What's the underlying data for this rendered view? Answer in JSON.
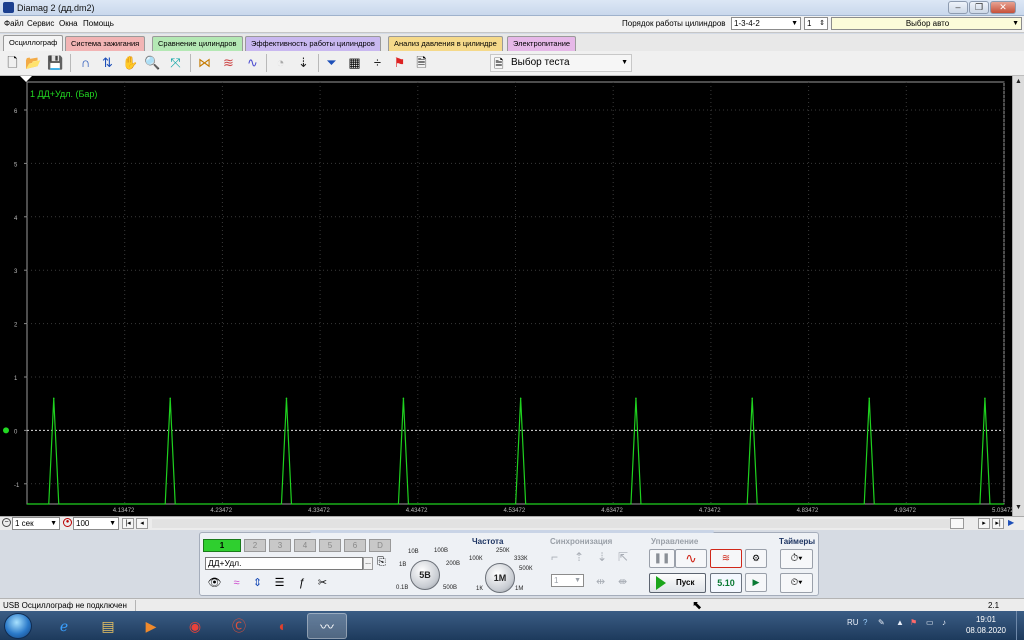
{
  "window": {
    "title": "Diamag 2 (дд.dm2)",
    "minimize": "–",
    "maximize": "❐",
    "close": "✕"
  },
  "menu": {
    "items": [
      "Файл",
      "Сервис",
      "Окна",
      "Помощь"
    ],
    "cylinder_order_label": "Порядок работы цилиндров",
    "cylinder_order_value": "1-3-4-2",
    "cylinder_number_value": "1",
    "auto_select": "Выбор авто"
  },
  "tabs": [
    {
      "label": "Осциллограф",
      "color": "#f4f4f4",
      "active": true
    },
    {
      "label": "Система зажигания",
      "color": "#f2b4b4"
    },
    {
      "label": "Сравнение цилиндров",
      "color": "#b4e8b4"
    },
    {
      "label": "Эффективность работы цилиндров",
      "color": "#c9b8f0"
    },
    {
      "label": "Анализ давления в цилиндре",
      "color": "#f5d98a"
    },
    {
      "label": "Электропитание",
      "color": "#e6b8e8"
    }
  ],
  "toolbar": {
    "test_select": "Выбор теста"
  },
  "plot": {
    "channel_label": "1 ДД+Удл. (Бар)",
    "background": "#000000",
    "trace_color": "#1fd11f",
    "grid": true,
    "x_range": [
      4.03472,
      5.03472
    ],
    "y_range": [
      -1.2,
      6.5
    ],
    "x_ticks": [
      "4.13472",
      "4.23472",
      "4.33472",
      "4.43472",
      "4.53472",
      "4.63472",
      "4.73472",
      "4.83472",
      "4.93472",
      "5.03472"
    ],
    "y_ticks": [
      "6",
      "5",
      "4",
      "3",
      "2",
      "1",
      "0",
      "-1"
    ]
  },
  "chart_data": {
    "type": "line",
    "title": "1 ДД+Удл. (Бар)",
    "xlabel": "",
    "ylabel": "",
    "xlim": [
      4.03472,
      5.03472
    ],
    "ylim": [
      -1.2,
      6.5
    ],
    "grid": true,
    "series": [
      {
        "name": "1 ДД+Удл. (Бар)",
        "peaks_x": [
          4.0621,
          4.1813,
          4.3003,
          4.42,
          4.54,
          4.658,
          4.777,
          4.8968,
          5.0152
        ],
        "peak_value": 0.6,
        "baseline_value": -1.2
      }
    ]
  },
  "nav": {
    "time_scale": "1 сек",
    "zoom": "100"
  },
  "channels": {
    "buttons": [
      "1",
      "2",
      "3",
      "4",
      "5",
      "6",
      "D"
    ],
    "selected_sensor": "ДД+Удл.",
    "more": "..."
  },
  "voltage": {
    "knob_value": "5В",
    "labels": [
      "10В",
      "100В",
      "200В",
      "500В",
      "0.1В",
      "1В"
    ]
  },
  "frequency": {
    "title": "Частота",
    "knob_value": "1М",
    "labels": [
      "100К",
      "250К",
      "333К",
      "500К",
      "1М",
      "1К"
    ]
  },
  "sync": {
    "title": "Синхронизация",
    "value": "1"
  },
  "control": {
    "title": "Управление",
    "start": "Пуск",
    "version": "5.10"
  },
  "timers": {
    "title": "Таймеры"
  },
  "status": {
    "text": "USB Осциллограф не подключен",
    "version": "2.1"
  },
  "taskbar": {
    "lang": "RU",
    "time": "19:01",
    "date": "08.08.2020"
  }
}
